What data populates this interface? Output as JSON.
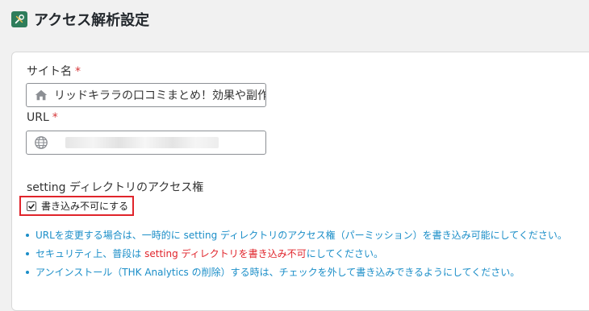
{
  "header": {
    "title": "アクセス解析設定",
    "icon": "tools-icon"
  },
  "form": {
    "site_name": {
      "label": "サイト名",
      "required_mark": "*",
      "value": "リッドキララの口コミまとめ！効果や副作",
      "icon": "home-icon"
    },
    "url": {
      "label": "URL",
      "required_mark": "*",
      "value": "",
      "icon": "globe-icon"
    },
    "setting_access": {
      "label": "setting ディレクトリのアクセス権",
      "checkbox_label": "書き込み不可にする",
      "checked": true
    }
  },
  "notes": [
    {
      "text": "URLを変更する場合は、一時的に setting ディレクトリのアクセス権（パーミッション）を書き込み可能にしてください。"
    },
    {
      "prefix": "セキュリティ上、普段は ",
      "highlight": "setting ディレクトリを書き込み不可",
      "suffix": "にしてください。"
    },
    {
      "text": "アンインストール（THK Analytics の削除）する時は、チェックを外して書き込みできるようにしてください。"
    }
  ],
  "colors": {
    "accent_red": "#e0242b",
    "note_blue": "#1b8ec8",
    "icon_green": "#2e7d5b"
  }
}
